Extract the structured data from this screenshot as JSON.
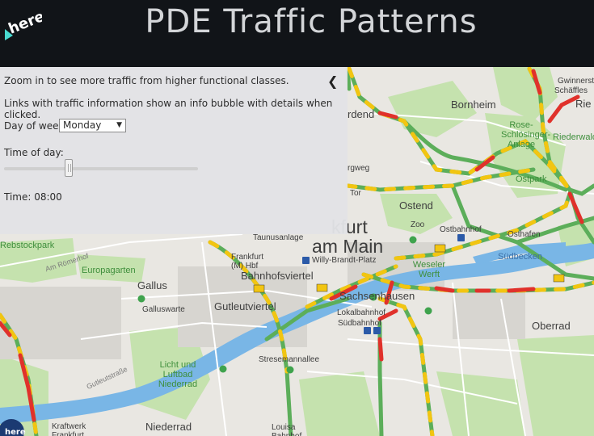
{
  "header": {
    "title": "PDE Traffic Patterns",
    "logo_text": "here"
  },
  "panel": {
    "hint": "Zoom in to see more traffic from higher functional classes.",
    "info": "Links with traffic information show an info bubble with details when clicked.",
    "day_label": "Day of week",
    "day_value": "Monday",
    "time_label": "Time of day:",
    "time_level_fraction": 0.333,
    "time_readout": "Time: 08:00",
    "collapse_icon": "chevron-left-icon"
  },
  "map": {
    "city_labels": [
      "kfurt",
      "am Main",
      "Bornheim",
      "Ostend",
      "Sachsenhausen",
      "Oberrad",
      "Gallus",
      "Gutleutviertel",
      "Bahnhofsviertel",
      "Niederrad",
      "rdend",
      "Gwinnerst",
      "Schäffles",
      "Rie"
    ],
    "place_labels": [
      "Taunusanlage",
      "Willy-Brandt-Platz",
      "Lokalbahnhof",
      "Südbahnhof",
      "Stresemannallee",
      "Galluswarte",
      "Ostbahnhof",
      "Ostpark",
      "Osthafen",
      "Zoo",
      "Rose-Schlösinger-Anlage",
      "Südbecken",
      "Weseler Werft",
      "Europagarten",
      "Rebstockpark",
      "Licht und Luftbad Niederrad",
      "Kraftwerk Frankfurt",
      "Louisa Bahnhof",
      "Riederwald",
      "Frankfurt (M) Hbf",
      "rgweg",
      "Tor"
    ],
    "street_labels": [
      "Am Römerhof",
      "Gutleutstraße"
    ],
    "colors": {
      "free_flow": "#5cae5a",
      "slow": "#f2c511",
      "jam": "#e0312b",
      "water": "#6fb1e3",
      "park": "#c8e3b0"
    }
  }
}
